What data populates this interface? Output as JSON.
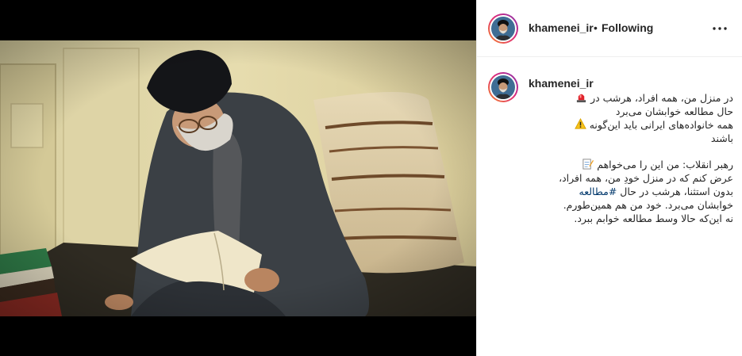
{
  "post": {
    "username": "khamenei_ir",
    "separator": "•",
    "follow_status": "Following",
    "more_icon": "more-horizontal-icon"
  },
  "caption": {
    "username": "khamenei_ir",
    "line1_text": "در منزل من، همه افراد، هرشب در",
    "line1_emoji": "police-light-emoji",
    "line2_text": "حال مطالعه خوابشان می‌برد",
    "line3_text": "همه خانواده‌های ایرانی باید این‌گونه",
    "line3_emoji": "warning-emoji",
    "line4_text": "باشند",
    "line5_text": "رهبر انقلاب: من این را می‌خواهم",
    "line5_emoji": "memo-emoji",
    "line6_text": "عرض کنم که در منزل خودِ من، همه افراد،",
    "line7_text": "بدون استثنا، هرشب در حال",
    "line7_hashtag": "#مطالعه",
    "line8_text": "خوابشان می‌برد. خود من هم همین‌طورم.",
    "line9_text": "نه این‌که حالا وسط مطالعه خوابم ببرد."
  },
  "colors": {
    "text": "#262626",
    "hashtag": "#00376b",
    "divider": "#efefef",
    "media_background": "#000000"
  }
}
